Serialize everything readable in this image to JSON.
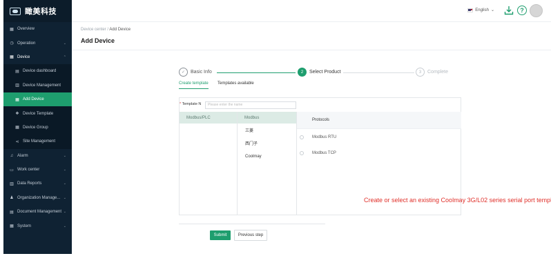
{
  "brand": {
    "title": "瞰美科技"
  },
  "sidebar": {
    "items": [
      {
        "label": "Overview",
        "icon": "grid-icon",
        "glyph": "▦",
        "chevron": ""
      },
      {
        "label": "Operation",
        "icon": "clock-icon",
        "glyph": "◷",
        "chevron": "⌄"
      },
      {
        "label": "Device",
        "icon": "device-icon",
        "glyph": "▦",
        "chevron": "⌃",
        "open": true
      },
      {
        "label": "Device dashboard",
        "icon": "dashboard-icon",
        "glyph": "▤",
        "sub": true
      },
      {
        "label": "Device Management",
        "icon": "list-icon",
        "glyph": "▥",
        "sub": true
      },
      {
        "label": "Add Device",
        "icon": "add-device-icon",
        "glyph": "▦",
        "sub": true,
        "active": true
      },
      {
        "label": "Device Template",
        "icon": "template-icon",
        "glyph": "❖",
        "sub": true
      },
      {
        "label": "Device Group",
        "icon": "group-icon",
        "glyph": "▦",
        "sub": true
      },
      {
        "label": "Site Management",
        "icon": "share-icon",
        "glyph": "⋖",
        "sub": true
      },
      {
        "label": "Alarm",
        "icon": "bell-icon",
        "glyph": "♫",
        "chevron": "⌄"
      },
      {
        "label": "Work center",
        "icon": "workcenter-icon",
        "glyph": "▭",
        "chevron": "⌄"
      },
      {
        "label": "Data Reports",
        "icon": "chart-icon",
        "glyph": "▥",
        "chevron": "⌄"
      },
      {
        "label": "Organization Manage...",
        "icon": "org-icon",
        "glyph": "♟",
        "chevron": "⌄"
      },
      {
        "label": "Document Management",
        "icon": "document-icon",
        "glyph": "▤",
        "chevron": "⌄"
      },
      {
        "label": "System",
        "icon": "system-icon",
        "glyph": "▦",
        "chevron": "⌄"
      }
    ]
  },
  "header": {
    "language": "English",
    "language_chevron": "⌄",
    "help": "?"
  },
  "breadcrumb": {
    "parent": "Device center",
    "sep": "/",
    "current": "Add Device"
  },
  "page": {
    "title": "Add Device"
  },
  "steps": [
    {
      "num": "✓",
      "label": "Basic Info",
      "state": "done"
    },
    {
      "num": "2",
      "label": "Select Product",
      "state": "current"
    },
    {
      "num": "3",
      "label": "Complete",
      "state": "pending"
    }
  ],
  "tabs": [
    {
      "label": "Create template",
      "active": true
    },
    {
      "label": "Templates available",
      "active": false
    }
  ],
  "form": {
    "template_label_req": "*",
    "template_label": "Template N",
    "template_placeholder": "Please enter the name"
  },
  "col1": {
    "selected": "Modbus/PLC"
  },
  "col2": {
    "selected": "Modbus",
    "items": [
      "三菱",
      "西门子",
      "Coolmay"
    ]
  },
  "protocols": {
    "header": "Protocols",
    "items": [
      "Modbus RTU",
      "Modbus TCP"
    ]
  },
  "note": "Create or select an existing Coolmay 3G/L02 series serial port template",
  "buttons": {
    "submit": "Submit",
    "previous": "Previous step"
  },
  "colors": {
    "accent": "#1e9e6e",
    "sidebar": "#0f2233",
    "note": "#e0302a"
  }
}
